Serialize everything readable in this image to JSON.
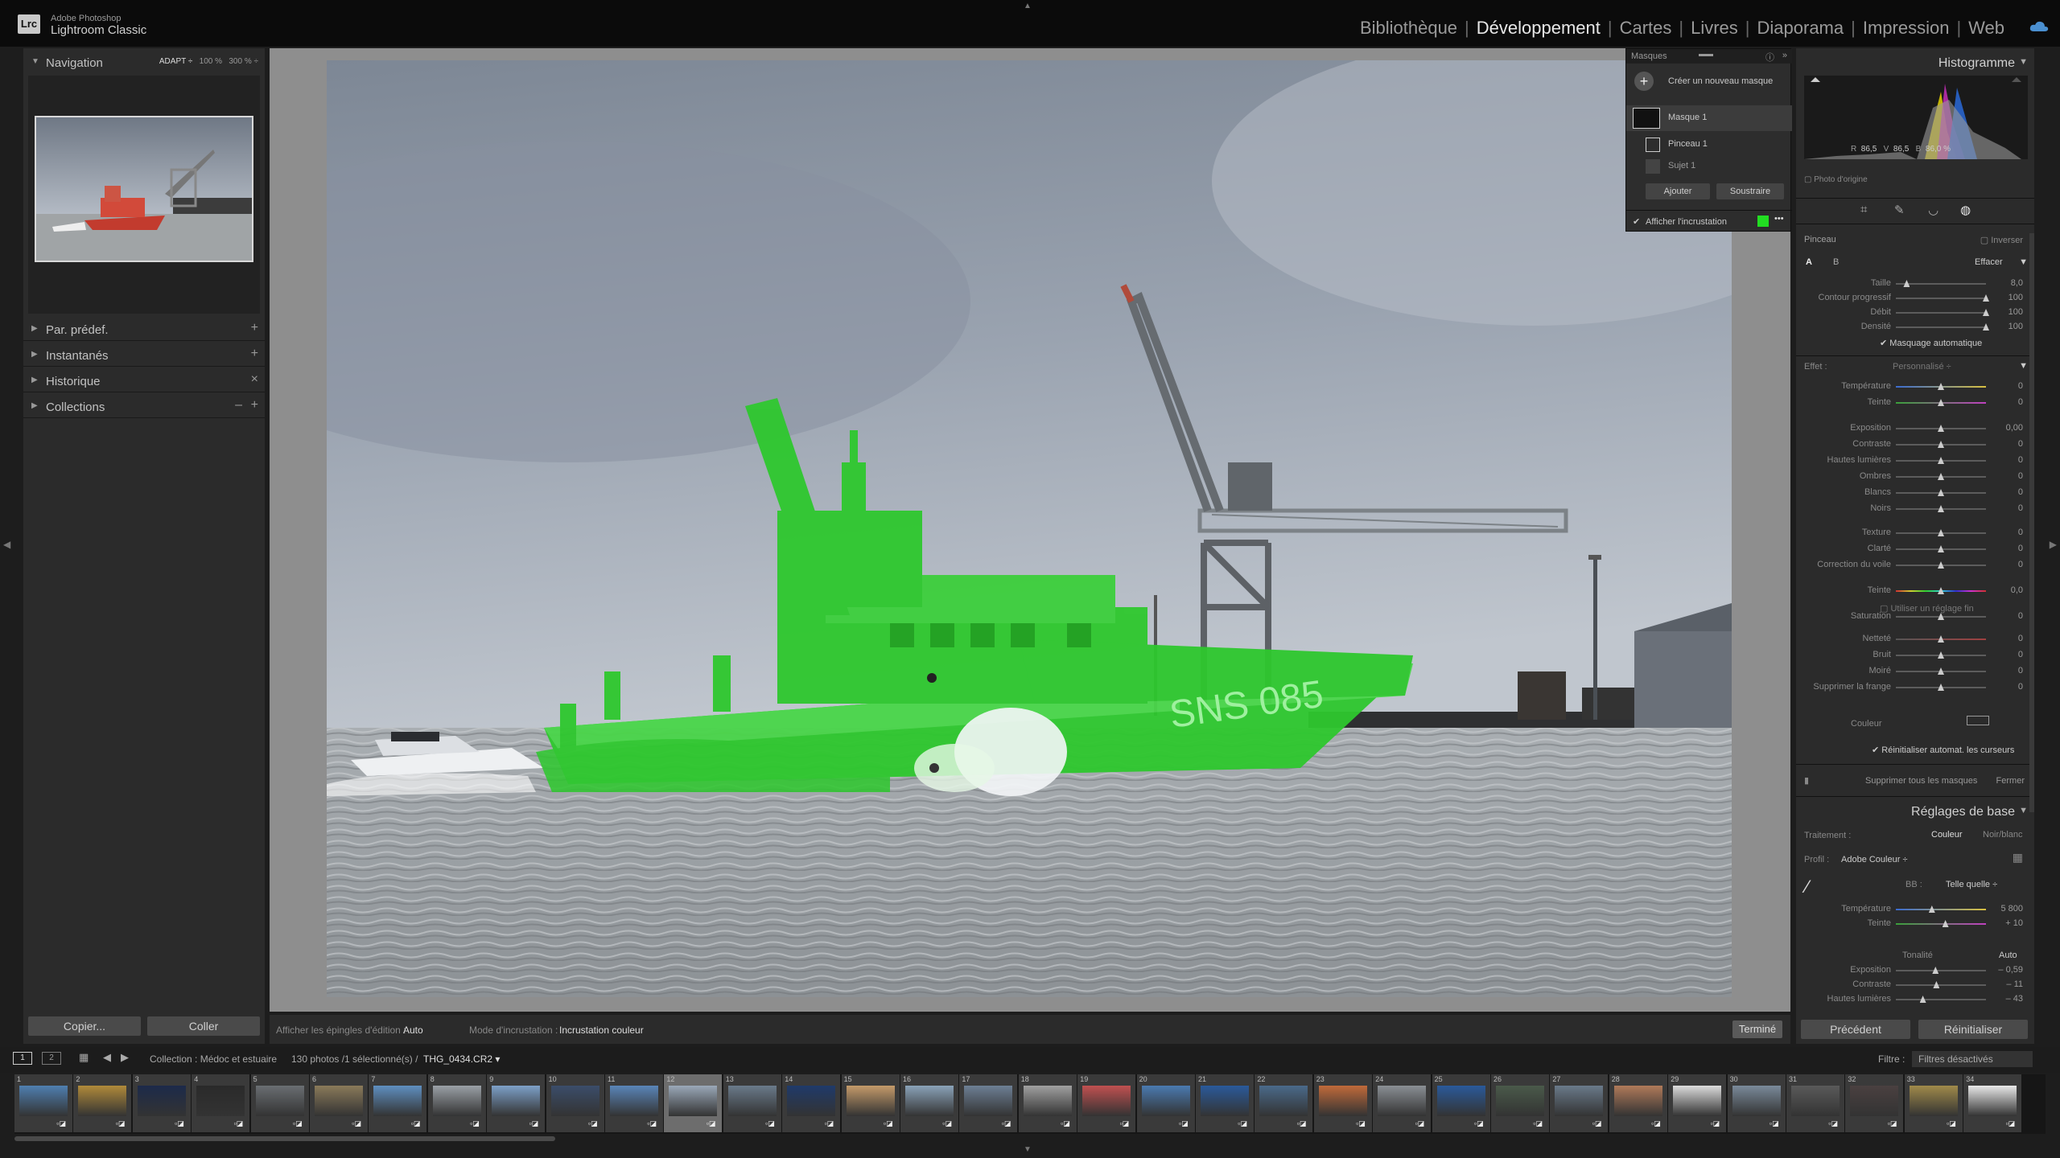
{
  "app": {
    "subtitle": "Adobe Photoshop",
    "name": "Lightroom Classic",
    "logo": "Lrc"
  },
  "modules": [
    {
      "label": "Bibliothèque",
      "active": false
    },
    {
      "label": "Développement",
      "active": true
    },
    {
      "label": "Cartes",
      "active": false
    },
    {
      "label": "Livres",
      "active": false
    },
    {
      "label": "Diaporama",
      "active": false
    },
    {
      "label": "Impression",
      "active": false
    },
    {
      "label": "Web",
      "active": false
    }
  ],
  "left": {
    "navigation": "Navigation",
    "nav_opt_adapt": "ADAPT ÷",
    "nav_opt_100": "100 %",
    "nav_opt_300": "300 % ÷",
    "presets": "Par. prédef.",
    "snapshots": "Instantanés",
    "history": "Historique",
    "collections": "Collections",
    "copy_btn": "Copier...",
    "paste_btn": "Coller"
  },
  "toolbar": {
    "pins_label": "Afficher les épingles d'édition :",
    "pins_value": "Auto",
    "overlay_label": "Mode d'incrustation :",
    "overlay_value": "Incrustation couleur",
    "done": "Terminé"
  },
  "photo": {
    "hull_text": "SNS 085"
  },
  "masks": {
    "title": "Masques",
    "create": "Créer un nouveau masque",
    "mask1": "Masque 1",
    "brush1": "Pinceau 1",
    "subject1": "Sujet 1",
    "add": "Ajouter",
    "subtract": "Soustraire",
    "show_overlay": "Afficher l'incrustation",
    "overlay_color": "#22dd22"
  },
  "right": {
    "histogram": "Histogramme",
    "rgb_r_label": "R",
    "rgb_r": "86,5",
    "rgb_v_label": "V",
    "rgb_v": "86,5",
    "rgb_b_label": "B",
    "rgb_b": "86,0 %",
    "original": "Photo d'origine",
    "brush": "Pinceau",
    "invert": "Inverser",
    "a": "A",
    "b": "B",
    "erase": "Effacer",
    "automask": "Masquage automatique",
    "effect": "Effet :",
    "effect_value": "Personnalisé ÷",
    "use_fine": "Utiliser un réglage fin",
    "color": "Couleur",
    "reset_sliders": "Réinitialiser automat. les curseurs",
    "delete_all": "Supprimer tous les masques",
    "close": "Fermer",
    "basic": "Réglages de base",
    "treatment": "Traitement :",
    "color_opt": "Couleur",
    "bw_opt": "Noir/blanc",
    "profile": "Profil :",
    "profile_value": "Adobe Couleur ÷",
    "wb_label": "BB :",
    "wb_value": "Telle quelle ÷",
    "tone": "Tonalité",
    "auto": "Auto",
    "previous": "Précédent",
    "reset": "Réinitialiser"
  },
  "brush_sliders": [
    {
      "label": "Taille",
      "value": "8,0",
      "pos": 0.12
    },
    {
      "label": "Contour progressif",
      "value": "100",
      "pos": 1.0
    },
    {
      "label": "Débit",
      "value": "100",
      "pos": 1.0
    },
    {
      "label": "Densité",
      "value": "100",
      "pos": 1.0
    }
  ],
  "effect_sliders": [
    {
      "label": "Température",
      "value": "0"
    },
    {
      "label": "Teinte",
      "value": "0"
    },
    {
      "label": "Exposition",
      "value": "0,00"
    },
    {
      "label": "Contraste",
      "value": "0"
    },
    {
      "label": "Hautes lumières",
      "value": "0"
    },
    {
      "label": "Ombres",
      "value": "0"
    },
    {
      "label": "Blancs",
      "value": "0"
    },
    {
      "label": "Noirs",
      "value": "0"
    },
    {
      "label": "Texture",
      "value": "0"
    },
    {
      "label": "Clarté",
      "value": "0"
    },
    {
      "label": "Correction du voile",
      "value": "0"
    },
    {
      "label": "Teinte",
      "value": "0,0"
    },
    {
      "label": "Saturation",
      "value": "0"
    },
    {
      "label": "Netteté",
      "value": "0"
    },
    {
      "label": "Bruit",
      "value": "0"
    },
    {
      "label": "Moiré",
      "value": "0"
    },
    {
      "label": "Supprimer la frange",
      "value": "0"
    }
  ],
  "basic_sliders": [
    {
      "label": "Température",
      "value": "5 800",
      "pos": 0.4
    },
    {
      "label": "Teinte",
      "value": "+ 10",
      "pos": 0.55
    },
    {
      "label": "Exposition",
      "value": "– 0,59",
      "pos": 0.44
    },
    {
      "label": "Contraste",
      "value": "– 11",
      "pos": 0.45
    },
    {
      "label": "Hautes lumières",
      "value": "– 43",
      "pos": 0.3
    }
  ],
  "filmstrip": {
    "page1": "1",
    "page2": "2",
    "collection": "Collection : Médoc et estuaire",
    "count": "130 photos /1 sélectionné(s) /",
    "filename": "THG_0434.CR2 ▾",
    "filter_label": "Filtre :",
    "filter_value": "Filtres désactivés",
    "numbers": [
      "1",
      "2",
      "3",
      "4",
      "5",
      "6",
      "7",
      "8",
      "9",
      "10",
      "11",
      "12",
      "13",
      "14",
      "15",
      "16",
      "17",
      "18",
      "19",
      "20",
      "21",
      "22",
      "23",
      "24",
      "25",
      "26",
      "27",
      "28",
      "29",
      "30",
      "31",
      "32",
      "33",
      "34"
    ],
    "selected_index": 11
  }
}
